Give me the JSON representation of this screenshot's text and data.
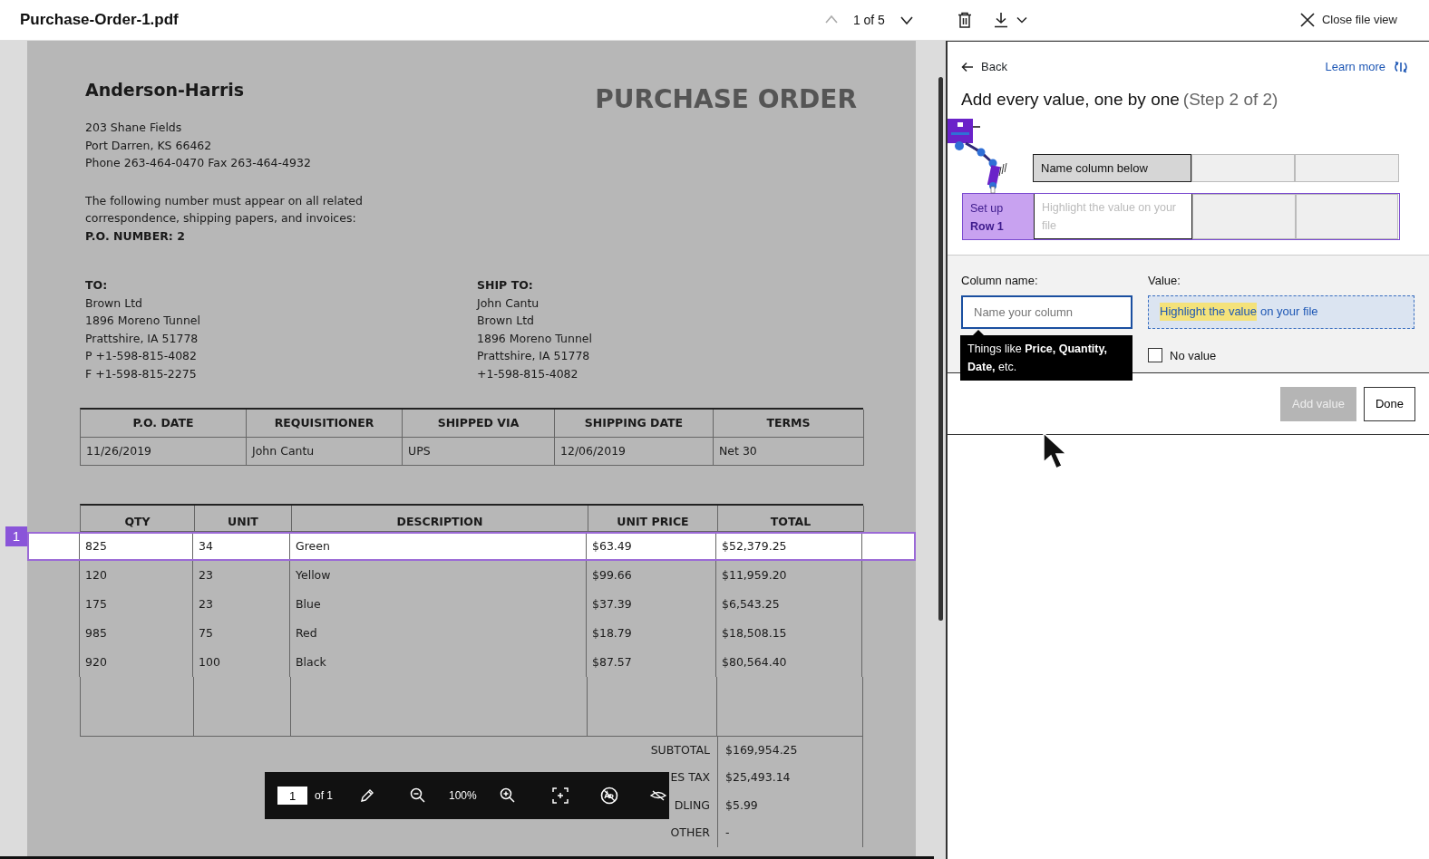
{
  "header": {
    "title": "Purchase-Order-1.pdf",
    "pager": {
      "text": "1 of 5",
      "prev_disabled": true,
      "next_disabled": false
    },
    "close": "Close file view"
  },
  "document": {
    "company": "Anderson-Harris",
    "doc_title": "PURCHASE ORDER",
    "address": [
      "203 Shane Fields",
      "Port Darren, KS 66462",
      "Phone 263-464-0470  Fax 263-464-4932"
    ],
    "notice": [
      "The following number must appear on all related",
      "correspondence, shipping papers, and invoices:",
      "**P.O. NUMBER: 2**"
    ],
    "to": {
      "heading": "TO:",
      "lines": [
        "Brown Ltd",
        "1896 Moreno Tunnel",
        "Prattshire, IA 51778",
        "P +1-598-815-4082",
        "F +1-598-815-2275"
      ]
    },
    "ship_to": {
      "heading": "SHIP TO:",
      "lines": [
        "John Cantu",
        "Brown Ltd",
        "1896 Moreno Tunnel",
        "Prattshire, IA 51778",
        "+1-598-815-4082"
      ]
    },
    "info_table": {
      "columns": [
        "P.O. DATE",
        "REQUISITIONER",
        "SHIPPED VIA",
        "SHIPPING DATE",
        "TERMS"
      ],
      "rows": [
        [
          "11/26/2019",
          "John Cantu",
          "UPS",
          "12/06/2019",
          "Net 30"
        ]
      ]
    },
    "items_table": {
      "columns": [
        "QTY",
        "UNIT",
        "DESCRIPTION",
        "UNIT PRICE",
        "TOTAL"
      ],
      "rows": [
        {
          "cells": [
            "825",
            "34",
            "Green",
            "$63.49",
            "$52,379.25"
          ],
          "selected": true,
          "marker": "1"
        },
        {
          "cells": [
            "120",
            "23",
            "Yellow",
            "$99.66",
            "$11,959.20"
          ],
          "selected": false
        },
        {
          "cells": [
            "175",
            "23",
            "Blue",
            "$37.39",
            "$6,543.25"
          ],
          "selected": false
        },
        {
          "cells": [
            "985",
            "75",
            "Red",
            "$18.79",
            "$18,508.15"
          ],
          "selected": false
        },
        {
          "cells": [
            "920",
            "100",
            "Black",
            "$87.57",
            "$80,564.40"
          ],
          "selected": false
        }
      ]
    },
    "totals": [
      {
        "label": "SUBTOTAL",
        "value": "$169,954.25"
      },
      {
        "label": "ES TAX",
        "value": "$25,493.14"
      },
      {
        "label": "DLING",
        "value": "$5.99"
      },
      {
        "label": "OTHER",
        "value": "-"
      }
    ]
  },
  "toolbar": {
    "page": "1",
    "of": "of 1",
    "zoom": "100%"
  },
  "panel": {
    "back": "Back",
    "learn_more": "Learn more",
    "heading": "Add every value, one by one",
    "step": "(Step 2 of 2)",
    "preview": {
      "column_header": "Name column below",
      "row_label": [
        "Set up",
        "Row 1"
      ],
      "cell_hint": "Highlight the value on your file"
    },
    "column_name": {
      "label": "Column name:",
      "placeholder": "Name your column"
    },
    "tooltip": "Things like **Price, Quantity, Date,** etc.",
    "value": {
      "label": "Value:",
      "highlighted": "Highlight the value",
      "rest": "on your file"
    },
    "no_value": {
      "label": "No value",
      "checked": false
    },
    "add_button": {
      "label": "Add value",
      "disabled": true
    },
    "done_button": "Done"
  }
}
